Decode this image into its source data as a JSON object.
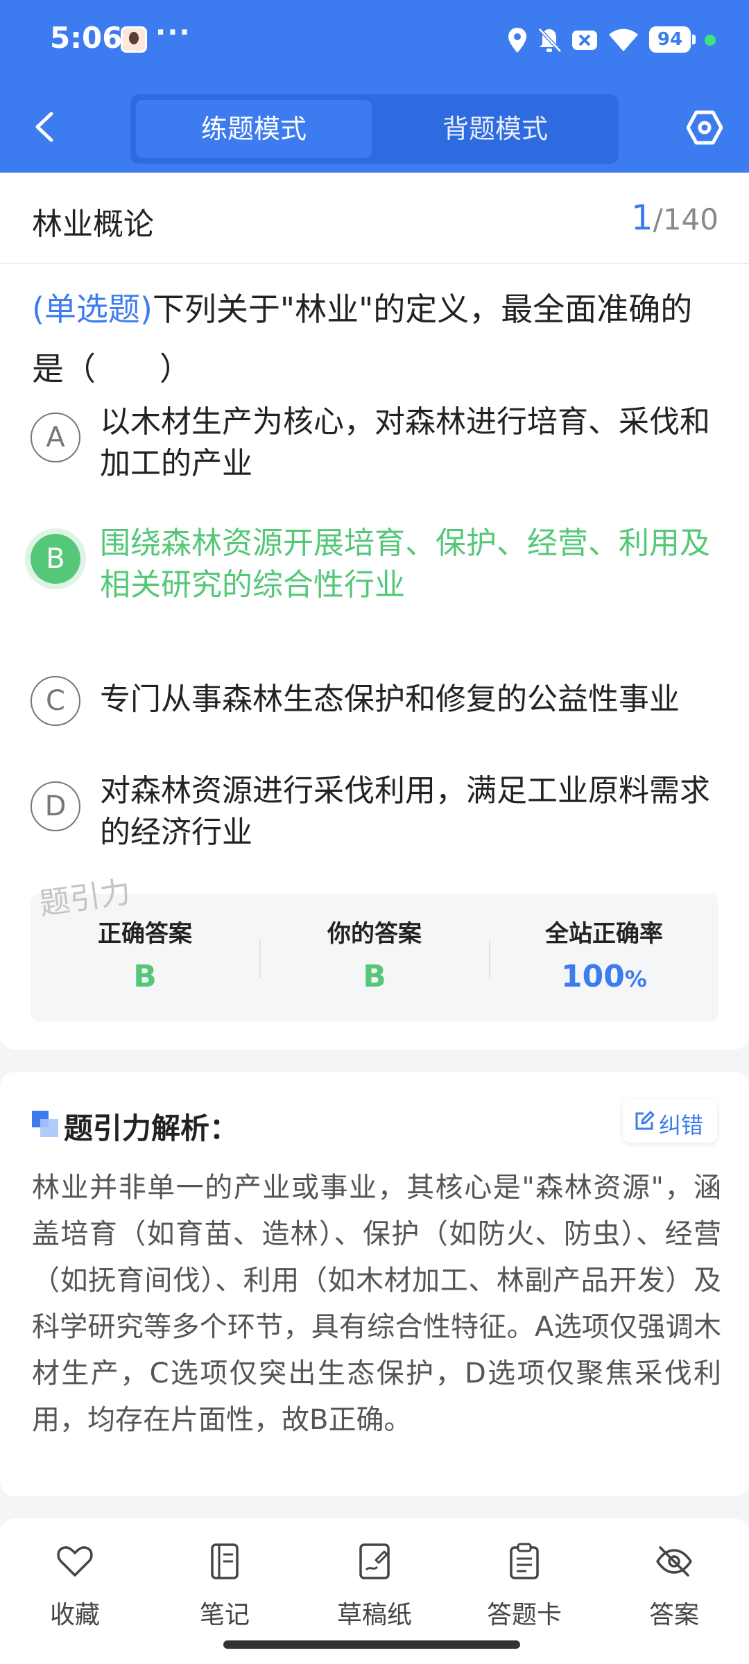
{
  "status_bar": {
    "time": "5:06",
    "dots": "···",
    "battery": "94",
    "icons": [
      "avatar-icon",
      "location-icon",
      "bell-off-icon",
      "close-badge-icon",
      "wifi-icon",
      "battery-icon"
    ]
  },
  "header": {
    "back_icon": "chevron-left-icon",
    "tabs": [
      {
        "label": "练题模式",
        "active": true
      },
      {
        "label": "背题模式",
        "active": false
      }
    ],
    "settings_icon": "settings-hex-icon",
    "accent": "#3d7cf0"
  },
  "question": {
    "subject": "林业概论",
    "current": "1",
    "total": "/140",
    "type": "(单选题)",
    "text": "下列关于\"林业\"的定义，最全面准确的是（　　）",
    "options": [
      {
        "letter": "A",
        "text": "以木材生产为核心，对森林进行培育、采伐和加工的产业"
      },
      {
        "letter": "B",
        "text": "围绕森林资源开展培育、保护、经营、利用及相关研究的综合性行业",
        "state": "correct"
      },
      {
        "letter": "C",
        "text": "专门从事森林生态保护和修复的公益性事业"
      },
      {
        "letter": "D",
        "text": "对森林资源进行采伐利用，满足工业原料需求的经济行业"
      }
    ],
    "watermark": "题引力"
  },
  "answer_summary": {
    "correct_label": "正确答案",
    "correct_value": "B",
    "yours_label": "你的答案",
    "yours_value": "B",
    "rate_label": "全站正确率",
    "rate_value": "100",
    "rate_unit": "%",
    "correct_color": "#54c878"
  },
  "analysis": {
    "title": "题引力解析：",
    "report_label": "纠错",
    "body": "林业并非单一的产业或事业，其核心是\"森林资源\"，涵盖培育（如育苗、造林）、保护（如防火、防虫）、经营（如抚育间伐）、利用（如木材加工、林副产品开发）及科学研究等多个环节，具有综合性特征。A选项仅强调木材生产，C选项仅突出生态保护，D选项仅聚焦采伐利用，均存在片面性，故B正确。"
  },
  "bottom_nav": [
    {
      "label": "收藏",
      "icon": "heart-icon"
    },
    {
      "label": "笔记",
      "icon": "notebook-icon"
    },
    {
      "label": "草稿纸",
      "icon": "draft-pen-icon"
    },
    {
      "label": "答题卡",
      "icon": "clipboard-icon"
    },
    {
      "label": "答案",
      "icon": "eye-off-icon"
    }
  ]
}
